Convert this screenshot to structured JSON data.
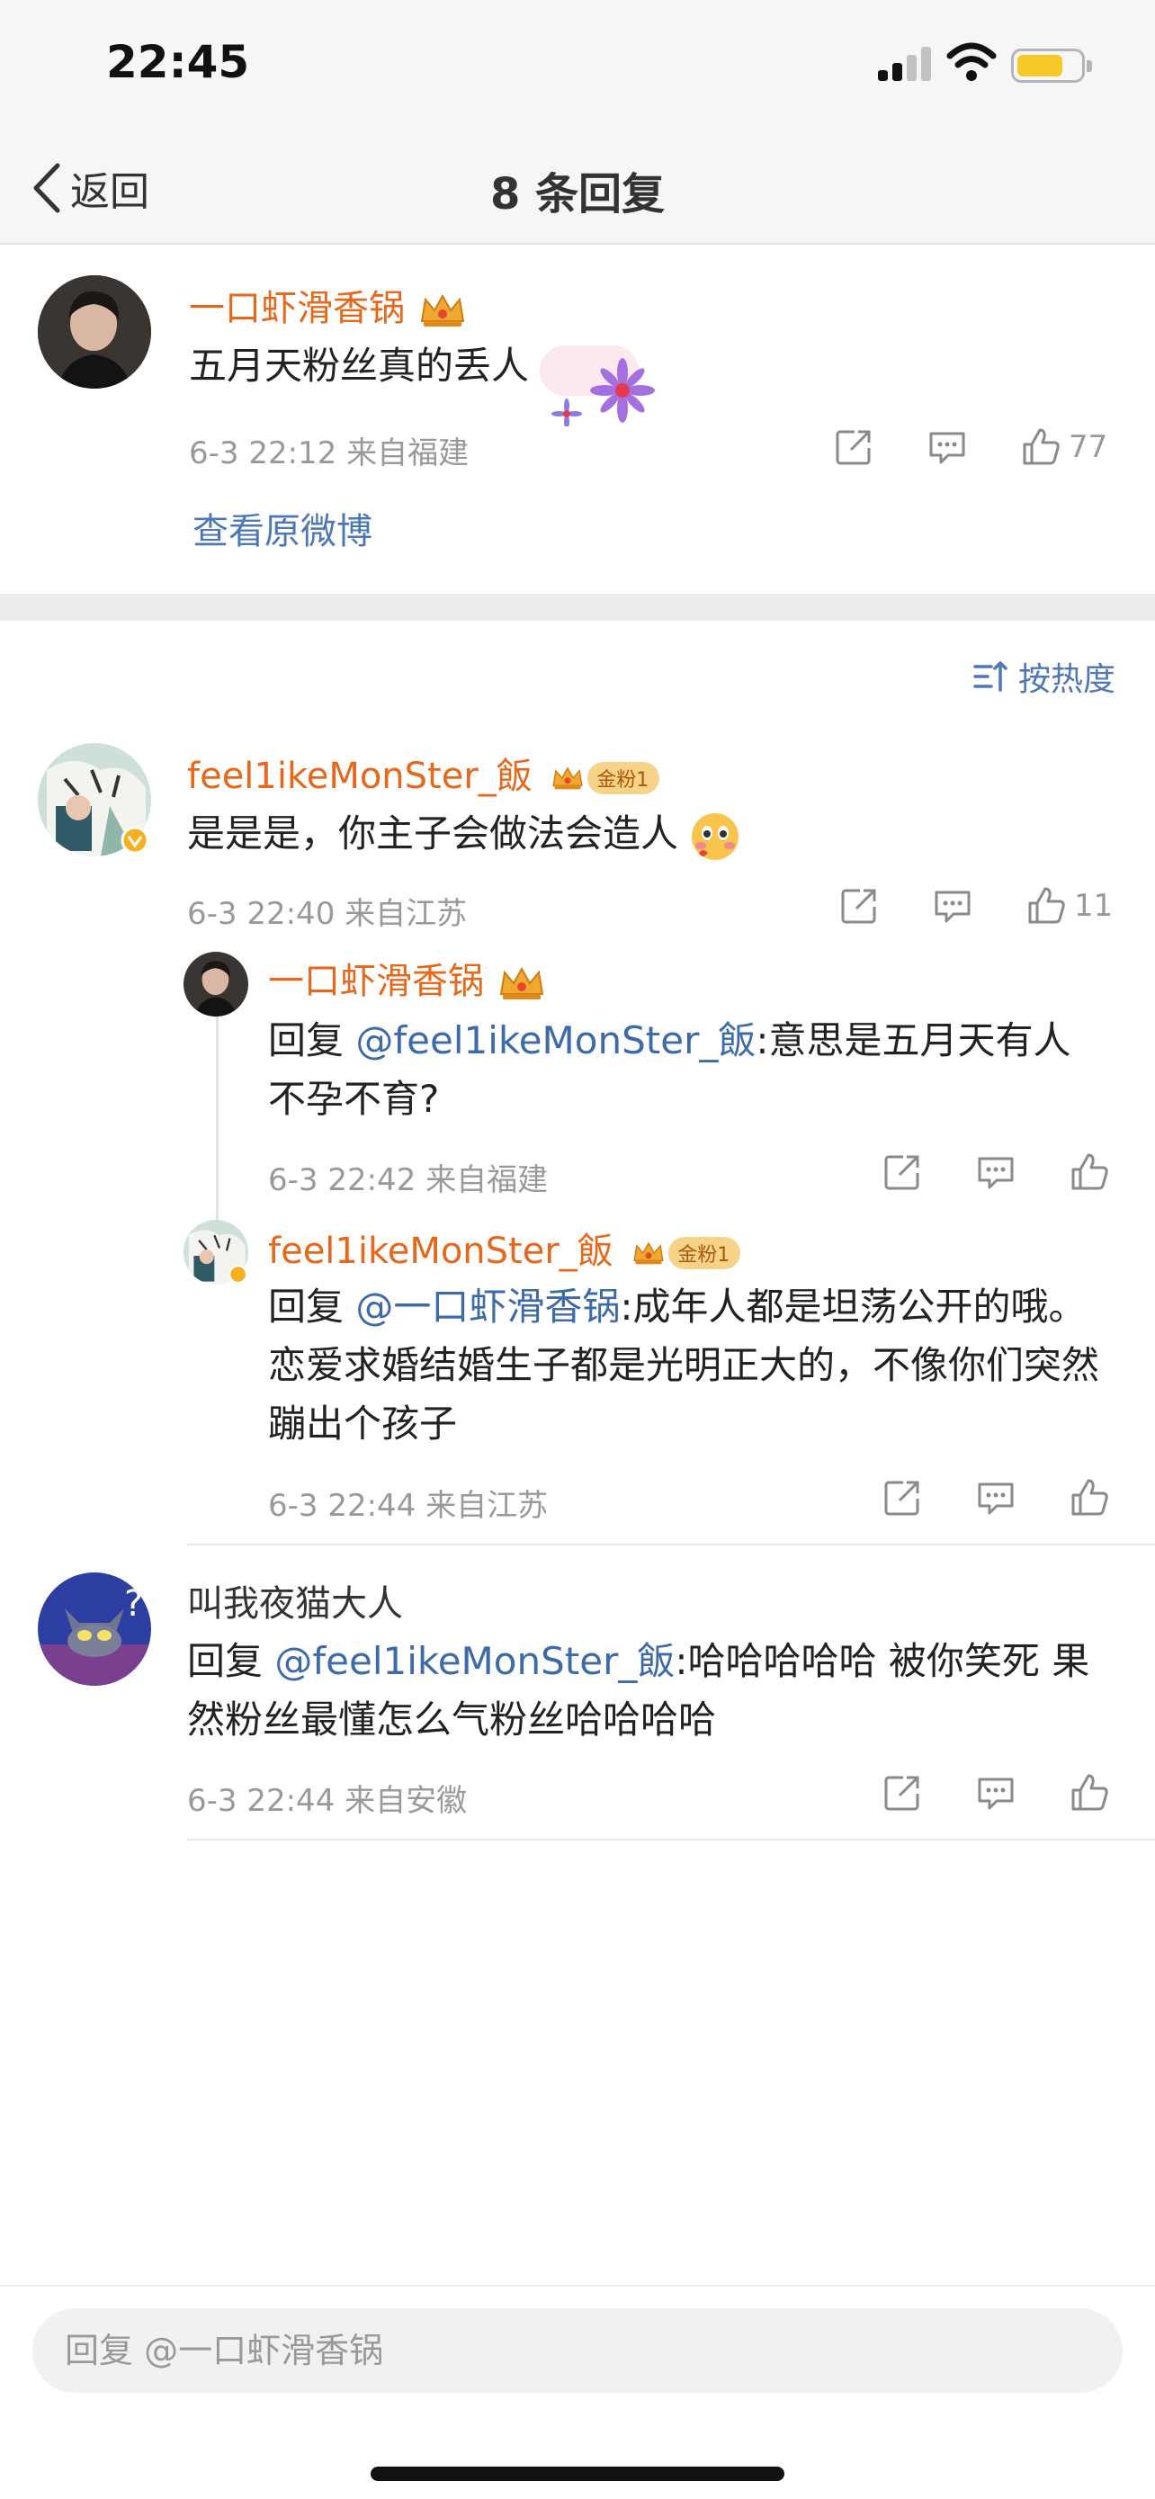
{
  "status_bar": {
    "time": "22:45"
  },
  "nav": {
    "back_label": "返回",
    "title": "8 条回复"
  },
  "root_comment": {
    "author": "一口虾滑香锅",
    "text": "五月天粉丝真的丢人",
    "time_location": "6-3 22:12  来自福建",
    "like_count": "77",
    "view_original": "查看原微博"
  },
  "sort_label": "按热度",
  "replies": [
    {
      "author": "feel1ikeMonSter_飯",
      "badge": "金粉1",
      "text": "是是是，你主子会做法会造人",
      "time_location": "6-3 22:40  来自江苏",
      "like_count": "11"
    },
    {
      "author": "一口虾滑香锅",
      "reply_prefix": "回复 ",
      "mention": "@feel1ikeMonSter_飯",
      "text": ":意思是五月天有人不孕不育?",
      "time_location": "6-3 22:42  来自福建"
    },
    {
      "author": "feel1ikeMonSter_飯",
      "badge": "金粉1",
      "reply_prefix": "回复 ",
      "mention": "@一口虾滑香锅",
      "text": ":成年人都是坦荡公开的哦。恋爱求婚结婚生子都是光明正大的，不像你们突然蹦出个孩子",
      "time_location": "6-3 22:44  来自江苏"
    },
    {
      "author": "叫我夜猫大人",
      "reply_prefix": "回复 ",
      "mention": "@feel1ikeMonSter_飯",
      "text": ":哈哈哈哈哈 被你笑死 果然粉丝最懂怎么气粉丝哈哈哈哈",
      "time_location": "6-3 22:44  来自安徽"
    }
  ],
  "input": {
    "placeholder": "回复 @一口虾滑香锅"
  },
  "colors": {
    "username": "#e5681b",
    "link": "#4d78b5",
    "meta": "#999999",
    "badge": "#f6d388"
  }
}
